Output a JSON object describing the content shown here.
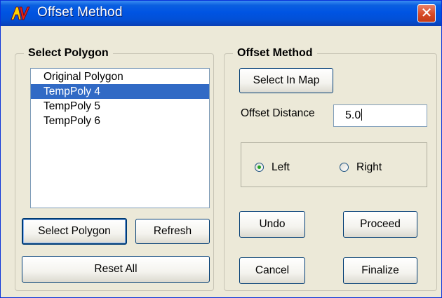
{
  "window": {
    "title": "Offset Method",
    "icon": "av-logo-icon",
    "close_glyph": "✕"
  },
  "select_polygon": {
    "legend": "Select Polygon",
    "items": [
      {
        "label": "Original Polygon",
        "selected": false
      },
      {
        "label": "TempPoly 4",
        "selected": true
      },
      {
        "label": "TempPoly 5",
        "selected": false
      },
      {
        "label": "TempPoly 6",
        "selected": false
      }
    ],
    "select_button": "Select Polygon",
    "refresh_button": "Refresh",
    "reset_button": "Reset All"
  },
  "offset_method": {
    "legend": "Offset Method",
    "select_in_map_button": "Select In Map",
    "distance_label": "Offset Distance",
    "distance_value": "5.0",
    "side": {
      "left_label": "Left",
      "right_label": "Right",
      "selected": "Left"
    },
    "undo_button": "Undo",
    "proceed_button": "Proceed",
    "cancel_button": "Cancel",
    "finalize_button": "Finalize"
  },
  "colors": {
    "titlebar": "#0054e3",
    "selection": "#316ac5",
    "dialog_bg": "#ece9d8",
    "radio_dot": "#21a121"
  }
}
